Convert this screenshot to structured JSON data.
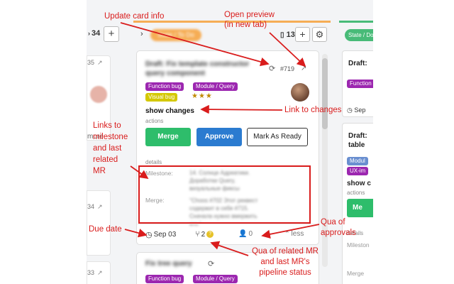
{
  "left_column": {
    "count": "34",
    "add_label": "+",
    "cards": [
      {
        "num": "35",
        "text": "more"
      },
      {
        "num": "34",
        "text": ""
      },
      {
        "num": "33",
        "text": ""
      }
    ]
  },
  "todo_column": {
    "tag": "State / To Do",
    "count": "13",
    "add_label": "+",
    "gear_icon": "gear-icon",
    "accent": "#f6ad55",
    "card": {
      "title": "Draft: Fix template constructor query component",
      "iid": "#719",
      "labels": [
        {
          "text": "Function bug",
          "color": "#9c27b0"
        },
        {
          "text": "Module / Query",
          "color": "#9c27b0"
        },
        {
          "text": "Visual bug",
          "color": "#d4c800"
        }
      ],
      "stars": "★★★",
      "changes_label": "show changes",
      "actions_label": "actions",
      "buttons": {
        "merge": "Merge",
        "approve": "Approve",
        "mark_ready": "Mark As Ready"
      },
      "details_label": "details",
      "milestone_label": "Milestone:",
      "milestone_value": "14. Солнце Адреатики. Доработки Query, визуальные фиксы",
      "merge_label": "Merge:",
      "merge_value": "\"Сhoos #702 Этот реквест содержит в себе #715. Сначала нужно вмержить его.\"",
      "due_date": "Sep 03",
      "related_mr_count": "2",
      "pipeline_status": "?",
      "approvals_count": "0",
      "less_label": "less"
    },
    "second_card_title": "Fix tree query"
  },
  "right_column": {
    "tag": "State / Done",
    "accent": "#48bb78",
    "cards": [
      {
        "title": "Draft:",
        "label": "Function"
      },
      {
        "title": "Draft: table",
        "labels": [
          "Modul",
          "UX-im"
        ],
        "changes": "show c",
        "actions": "actions",
        "merge_button": "Me",
        "details": "details",
        "milestone": "Mileston",
        "merge": "Merge"
      }
    ],
    "due": "Sep"
  },
  "annotations": {
    "update_card": "Update card info",
    "open_preview": "Open preview\n(in new tab)",
    "link_changes": "Link to changes",
    "links_milestone": "Links to\nmilestone\nand last\nrelated\nMR",
    "due_date": "Due date",
    "qua_approvals": "Qua of\napprovals",
    "qua_related": "Qua of related MR\nand last MR's\npipeline status"
  }
}
